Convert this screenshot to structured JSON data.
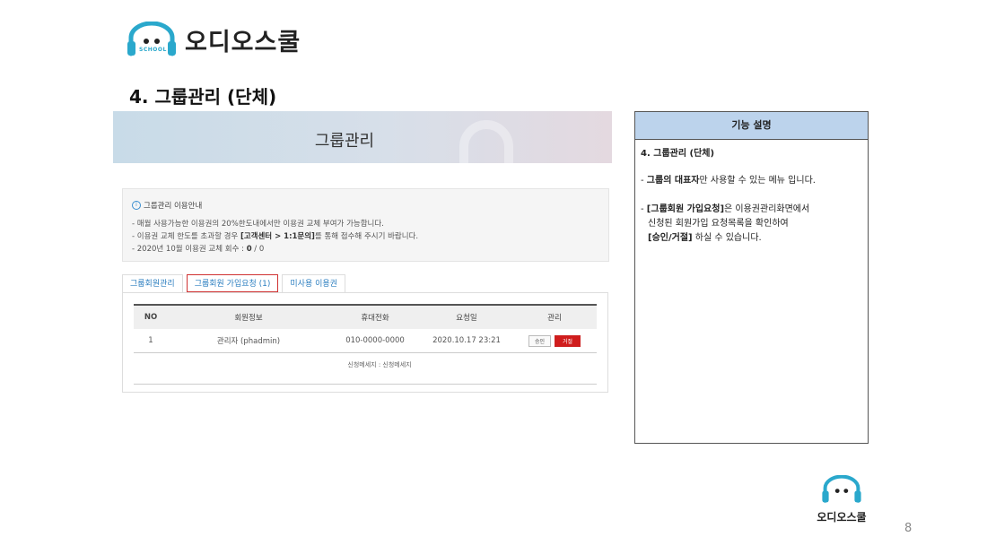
{
  "brand": {
    "name": "오디오스쿨",
    "school": "SCHOOL"
  },
  "section_title": "4. 그룹관리 (단체)",
  "banner": {
    "title": "그룹관리"
  },
  "info": {
    "heading": "그룹관리 이용안내",
    "line1": "- 매월 사용가능한 이용권의 20%한도내에서만 이용권 교체 부여가 가능합니다.",
    "line2_pre": "- 이용권 교체 한도를 초과할 경우 ",
    "line2_bold": "[고객센터 > 1:1문의]",
    "line2_post": "를 통해 접수해 주시기 바랍니다.",
    "line3_pre": "- 2020년 10월 이용권 교체 회수 : ",
    "line3_bold": "0",
    "line3_post": " / 0"
  },
  "tabs": [
    "그룹회원관리",
    "그룹회원 가입요청 (1)",
    "미사용 이용권"
  ],
  "table": {
    "headers": [
      "NO",
      "회원정보",
      "휴대전화",
      "요청일",
      "관리"
    ],
    "rows": [
      {
        "no": "1",
        "member": "관리자 (phadmin)",
        "phone": "010-0000-0000",
        "date": "2020.10.17 23:21",
        "approve": "승인",
        "reject": "거절"
      }
    ],
    "message": "신청메세지 : 신청메세지"
  },
  "description": {
    "header": "기능 설명",
    "title": "4. 그룹관리 (단체)",
    "p1_pre": "- ",
    "p1_bold": "그룹의 대표자",
    "p1_post": "만 사용할 수 있는 메뉴 입니다.",
    "p2_pre": "- ",
    "p2_bold": "[그룹회원 가입요청]",
    "p2_post": "은 이용권관리화면에서",
    "p2_line2": "신청된 회원가입 요청목록을 확인하여",
    "p2_line3_bold": "[승인/거절]",
    "p2_line3_post": " 하실 수 있습니다."
  },
  "page_number": "8",
  "colors": {
    "accent": "#2aa8cc",
    "reject": "#d01c1c",
    "desc_header": "#bcd3ec"
  }
}
